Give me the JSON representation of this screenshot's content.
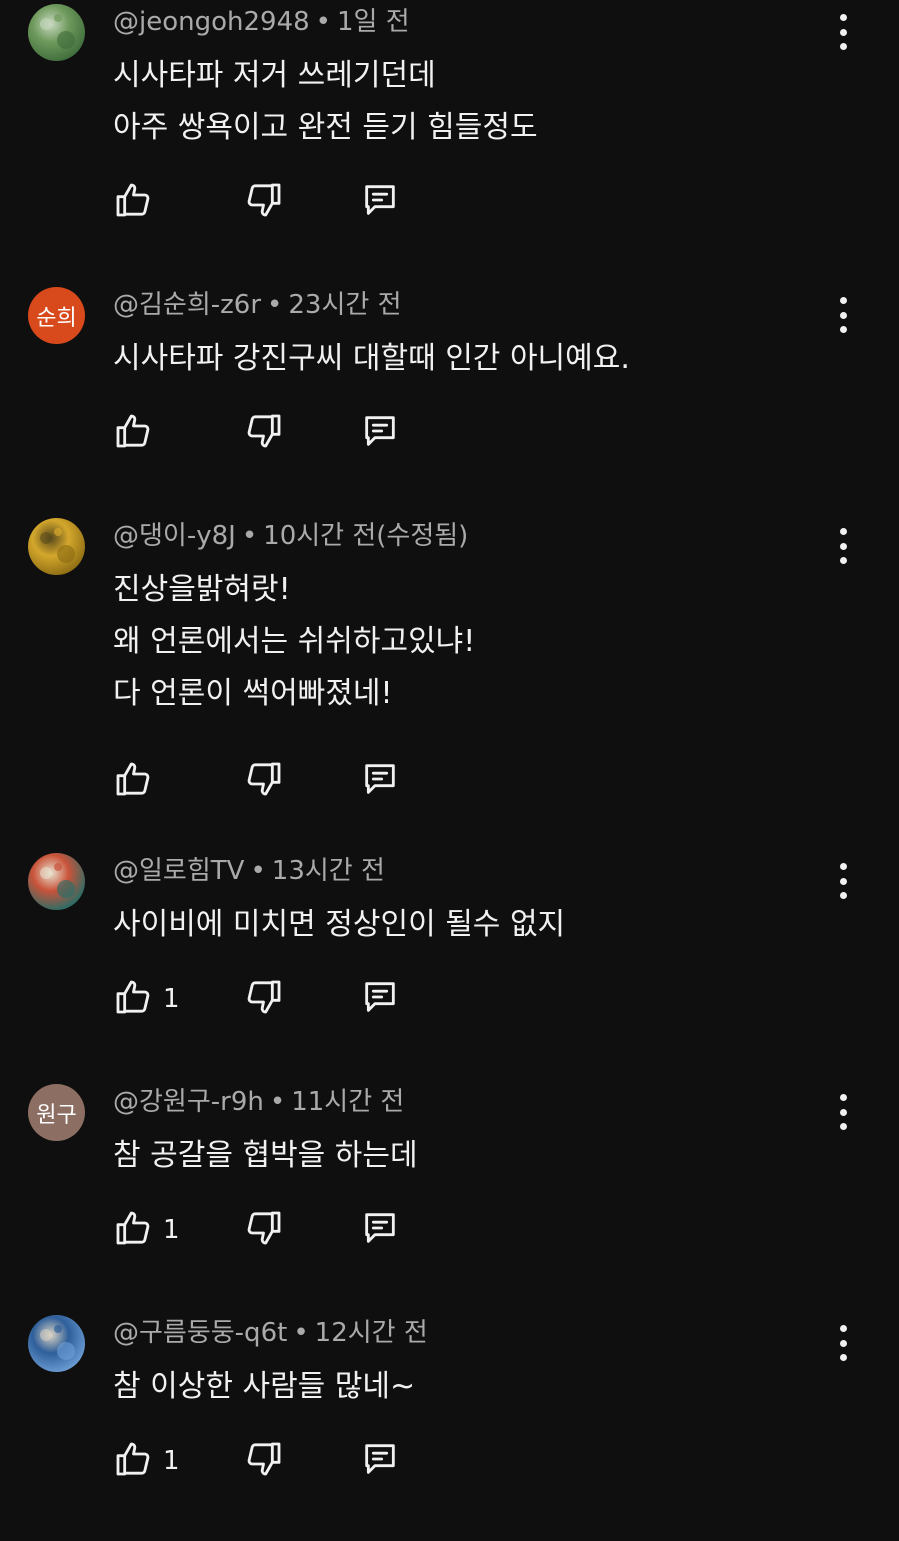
{
  "comments": [
    {
      "author": "@jeongoh2948",
      "separator": "•",
      "time": "1일 전",
      "lines": [
        "시사타파 저거 쓰레기던데",
        "아주 쌍욕이고 완전 듣기 힘들정도"
      ],
      "likes": "",
      "avatar": {
        "type": "image",
        "colors": [
          "#3d6b3a",
          "#6f9a5d",
          "#c8d8c0"
        ]
      }
    },
    {
      "author": "@김순희-z6r",
      "separator": "•",
      "time": "23시간 전",
      "lines": [
        "시사타파 강진구씨 대할때 인간 아니예요."
      ],
      "likes": "",
      "avatar": {
        "type": "text",
        "text": "순희",
        "color": "#d84a1b"
      }
    },
    {
      "author": "@댕이-y8J",
      "separator": "•",
      "time": "10시간 전(수정됨)",
      "lines": [
        "진상을밝혀랏!",
        "왜 언론에서는 쉬쉬하고있냐!",
        "다 언론이 썩어빠졌네!"
      ],
      "likes": "",
      "avatar": {
        "type": "image",
        "colors": [
          "#8a6a12",
          "#d4a72c",
          "#5a4a1c"
        ]
      }
    },
    {
      "author": "@일로힘TV",
      "separator": "•",
      "time": "13시간 전",
      "lines": [
        "사이비에 미치면 정상인이 될수 없지"
      ],
      "likes": "1",
      "avatar": {
        "type": "image",
        "colors": [
          "#1f6f6a",
          "#c9533a",
          "#e8e2cf"
        ]
      }
    },
    {
      "author": "@강원구-r9h",
      "separator": "•",
      "time": "11시간 전",
      "lines": [
        "참 공갈을 협박을 하는데"
      ],
      "likes": "1",
      "avatar": {
        "type": "text",
        "text": "원구",
        "color": "#8d6e63"
      }
    },
    {
      "author": "@구름둥둥-q6t",
      "separator": "•",
      "time": "12시간 전",
      "lines": [
        "참 이상한 사람들 많네~"
      ],
      "likes": "1",
      "avatar": {
        "type": "image",
        "colors": [
          "#6fa0d8",
          "#2f5f9a",
          "#d9d2c2"
        ]
      }
    }
  ],
  "icons": {
    "like": "thumb-up-icon",
    "dislike": "thumb-down-icon",
    "reply": "reply-comment-icon",
    "more": "more-vertical-icon"
  },
  "colors": {
    "background": "#0f0f0f",
    "text": "#f1f1f1",
    "meta": "#aaaaaa"
  }
}
